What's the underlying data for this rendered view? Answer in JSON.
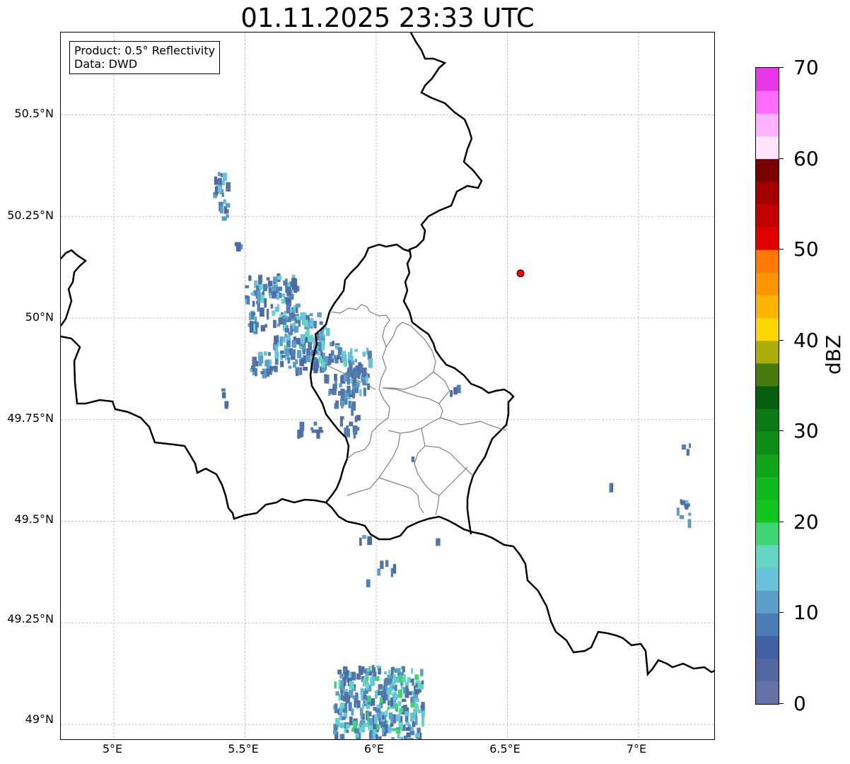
{
  "title": "01.11.2025 23:33 UTC",
  "info": {
    "product": "Product: 0.5° Reflectivity",
    "data": "Data: DWD"
  },
  "axes": {
    "lat_labels": [
      "50.5°N",
      "50.25°N",
      "50°N",
      "49.75°N",
      "49.5°N",
      "49.25°N",
      "49°N"
    ],
    "lon_labels": [
      "5°E",
      "5.5°E",
      "6°E",
      "6.5°E",
      "7°E"
    ],
    "lon_range": [
      4.8,
      7.3
    ],
    "lat_range": [
      48.95,
      50.7
    ]
  },
  "marker": {
    "name": "radar-site",
    "lon": 6.55,
    "lat": 50.11,
    "color": "#ff0000"
  },
  "colorbar": {
    "label": "dBZ",
    "min": 0,
    "max": 70,
    "ticks": [
      "0",
      "10",
      "20",
      "30",
      "40",
      "50",
      "60",
      "70"
    ],
    "colors": [
      "#6472a8",
      "#5368a0",
      "#4160a6",
      "#4b7cb5",
      "#5b9ec8",
      "#67c2da",
      "#62d6c3",
      "#3dd572",
      "#10c41b",
      "#10b91b",
      "#10a518",
      "#0b8d16",
      "#0a7a13",
      "#065e0e",
      "#447a0e",
      "#adad0a",
      "#ffd700",
      "#ffb400",
      "#ff9600",
      "#ff7800",
      "#e00000",
      "#c30000",
      "#a30000",
      "#7a0000",
      "#ffe3ff",
      "#ffb3ff",
      "#ff6bff",
      "#e837e8"
    ]
  },
  "colors": {
    "border": "#000000",
    "subregions": "#808080",
    "grid": "#b4b4b4"
  }
}
